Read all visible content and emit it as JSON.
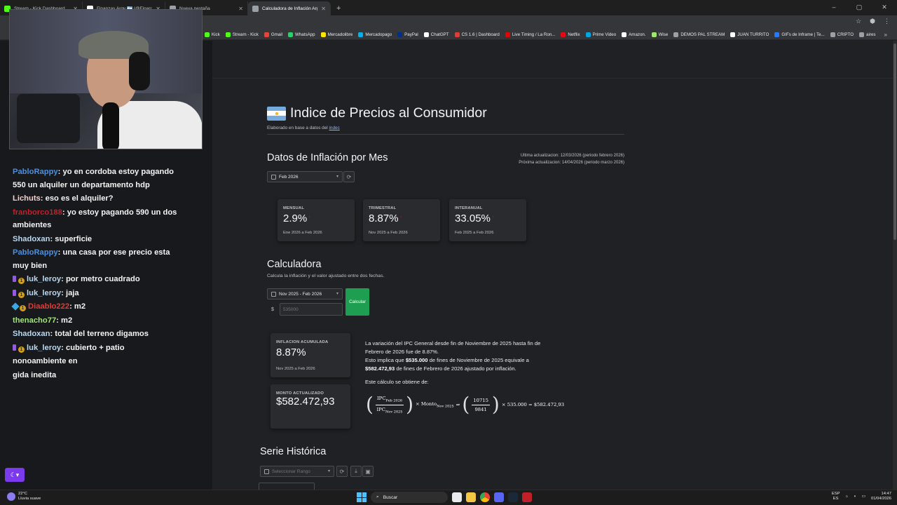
{
  "browser": {
    "tabs": [
      {
        "title": "Stream - Kick Dashboard",
        "color": "#53fc18",
        "active": false
      },
      {
        "title": "Finanzas Argy 🇦🇷 (@FinanzasArgy)",
        "color": "#ffffff",
        "active": false
      },
      {
        "title": "Nueva pestaña",
        "color": "#9aa0a6",
        "active": false
      },
      {
        "title": "Calculadora de Inflación Argentina",
        "color": "#9aa0a6",
        "active": true
      }
    ],
    "bookmarks": [
      {
        "label": "Kick",
        "color": "#53fc18"
      },
      {
        "label": "Stream - Kick",
        "color": "#53fc18"
      },
      {
        "label": "Gmail",
        "color": "#ea4335"
      },
      {
        "label": "WhatsApp",
        "color": "#25d366"
      },
      {
        "label": "Mercadolibre",
        "color": "#ffe600"
      },
      {
        "label": "Mercadopago",
        "color": "#00b1ea"
      },
      {
        "label": "PayPal",
        "color": "#003087"
      },
      {
        "label": "ChatGPT",
        "color": "#ffffff"
      },
      {
        "label": "CS 1.6 | Dashboard",
        "color": "#e53935"
      },
      {
        "label": "Live Timing / La Ron...",
        "color": "#e10600"
      },
      {
        "label": "Netflix",
        "color": "#e50914"
      },
      {
        "label": "Prime Video",
        "color": "#00a8e1"
      },
      {
        "label": "Amazon.",
        "color": "#ffffff"
      },
      {
        "label": "Wise",
        "color": "#9fe870"
      },
      {
        "label": "DEMOS PAL STREAM",
        "color": "#9aa0a6"
      },
      {
        "label": "JUAN TURRITO",
        "color": "#ffffff"
      },
      {
        "label": "GIFs de Inframe | Te...",
        "color": "#2979ff"
      },
      {
        "label": "CRIPTO",
        "color": "#9aa0a6"
      },
      {
        "label": "aires",
        "color": "#9aa0a6"
      }
    ]
  },
  "chat": [
    {
      "user": "PabloRappy",
      "color": "#4a90e2",
      "text": ": yo en cordoba estoy pagando 550 un alquiler un departamento hdp",
      "badges": []
    },
    {
      "user": "Lichuts",
      "color": "#f0d0d0",
      "text": ": eso es el alquiler?",
      "badges": []
    },
    {
      "user": "franborco188",
      "color": "#c0202a",
      "text": ": yo estoy pagando 590 un dos ambientes",
      "badges": []
    },
    {
      "user": "Shadoxan",
      "color": "#b8d8f0",
      "text": ": superficie",
      "badges": []
    },
    {
      "user": "PabloRappy",
      "color": "#4a90e2",
      "text": ": una casa por ese precio esta muy bien",
      "badges": []
    },
    {
      "user": "luk_leroy",
      "color": "#b8d8f0",
      "text": ": por metro cuadrado",
      "badges": [
        "p",
        "c"
      ]
    },
    {
      "user": "luk_leroy",
      "color": "#b8d8f0",
      "text": ": jaja",
      "badges": [
        "p",
        "c"
      ]
    },
    {
      "user": "Diaablo222",
      "color": "#e53935",
      "text": ": m2",
      "badges": [
        "b",
        "c"
      ]
    },
    {
      "user": "thenacho77",
      "color": "#9fe870",
      "text": ": m2",
      "badges": []
    },
    {
      "user": "Shadoxan",
      "color": "#b8d8f0",
      "text": ": total del terreno digamos",
      "badges": []
    },
    {
      "user": "luk_leroy",
      "color": "#b8d8f0",
      "text": ": cubierto + patio",
      "badges": [
        "p",
        "c"
      ]
    },
    {
      "user": "",
      "color": "#ffffff",
      "text": "nonoambiente en",
      "badges": []
    },
    {
      "user": "",
      "color": "#ffffff",
      "text": "ɡida inedita",
      "badges": []
    }
  ],
  "header": {
    "title": "Indice de Precios al Consumidor",
    "subtitle_prefix": "Elaborado en base a datos del ",
    "subtitle_link": "indec"
  },
  "inflation": {
    "heading": "Datos de Inflación por Mes",
    "last_update": "Ultima actualizacion: 12/03/2026 (periodo febrero 2026)",
    "next_update": "Próxima actualizacion: 14/04/2026 (periodo marzo 2026)",
    "month_select": "Feb 2026",
    "cards": [
      {
        "label": "MENSUAL",
        "value": "2.9%",
        "range": "Ene 2026 a Feb 2026"
      },
      {
        "label": "TRIMESTRAL",
        "value": "8.87%",
        "range": "Nov 2025 a Feb 2026"
      },
      {
        "label": "INTERANUAL",
        "value": "33.05%",
        "range": "Feb 2025 a Feb 2026"
      }
    ],
    "trend_arrow": "↑",
    "trend_color": "#c5221f"
  },
  "calculator": {
    "heading": "Calculadora",
    "description": "Calcula la inflación y el valor ajustado entre dos fechas.",
    "range_select": "Nov 2025 - Feb 2026",
    "currency": "$",
    "amount_placeholder": "535000",
    "button": "Calcular",
    "button_color": "#1e9e50",
    "acc_label": "INFLACION ACUMULADA",
    "acc_value": "8.87%",
    "acc_range": "Nov 2025 a Feb 2026",
    "upd_label": "MONTO ACTUALIZADO",
    "upd_value": "$582.472,93",
    "result_line1": "La variación del IPC General desde fin de Noviembre de 2025 hasta fin de Febrero de 2026 fue de 8.87%.",
    "result_line2_a": "Esto implica que ",
    "result_line2_b": "$535.000",
    "result_line2_c": " de fines de Noviembre de 2025 equivale a ",
    "result_line2_d": "$582.472,93",
    "result_line2_e": " de fines de Febrero de 2026 ajustado por inflación.",
    "formula_label": "Este cálculo se obtiene de:",
    "formula": {
      "ipc": "IPC",
      "sub_top": "Feb 2026",
      "sub_bottom": "Nov 2025",
      "monto": "× Monto",
      "monto_sub": "Nov 2025",
      "implies": "⇒",
      "num": "10715",
      "den": "9841",
      "times_amount": "× 535.000 = $582.472,93"
    }
  },
  "serie": {
    "heading": "Serie Histórica",
    "range_placeholder": "Seleccionar Rango"
  },
  "taskbar": {
    "temp": "22°C",
    "weather": "Lluvia suave",
    "search": "Buscar",
    "lang1": "ESP",
    "lang2": "ES",
    "time": "14:47",
    "date": "01/04/2026"
  }
}
